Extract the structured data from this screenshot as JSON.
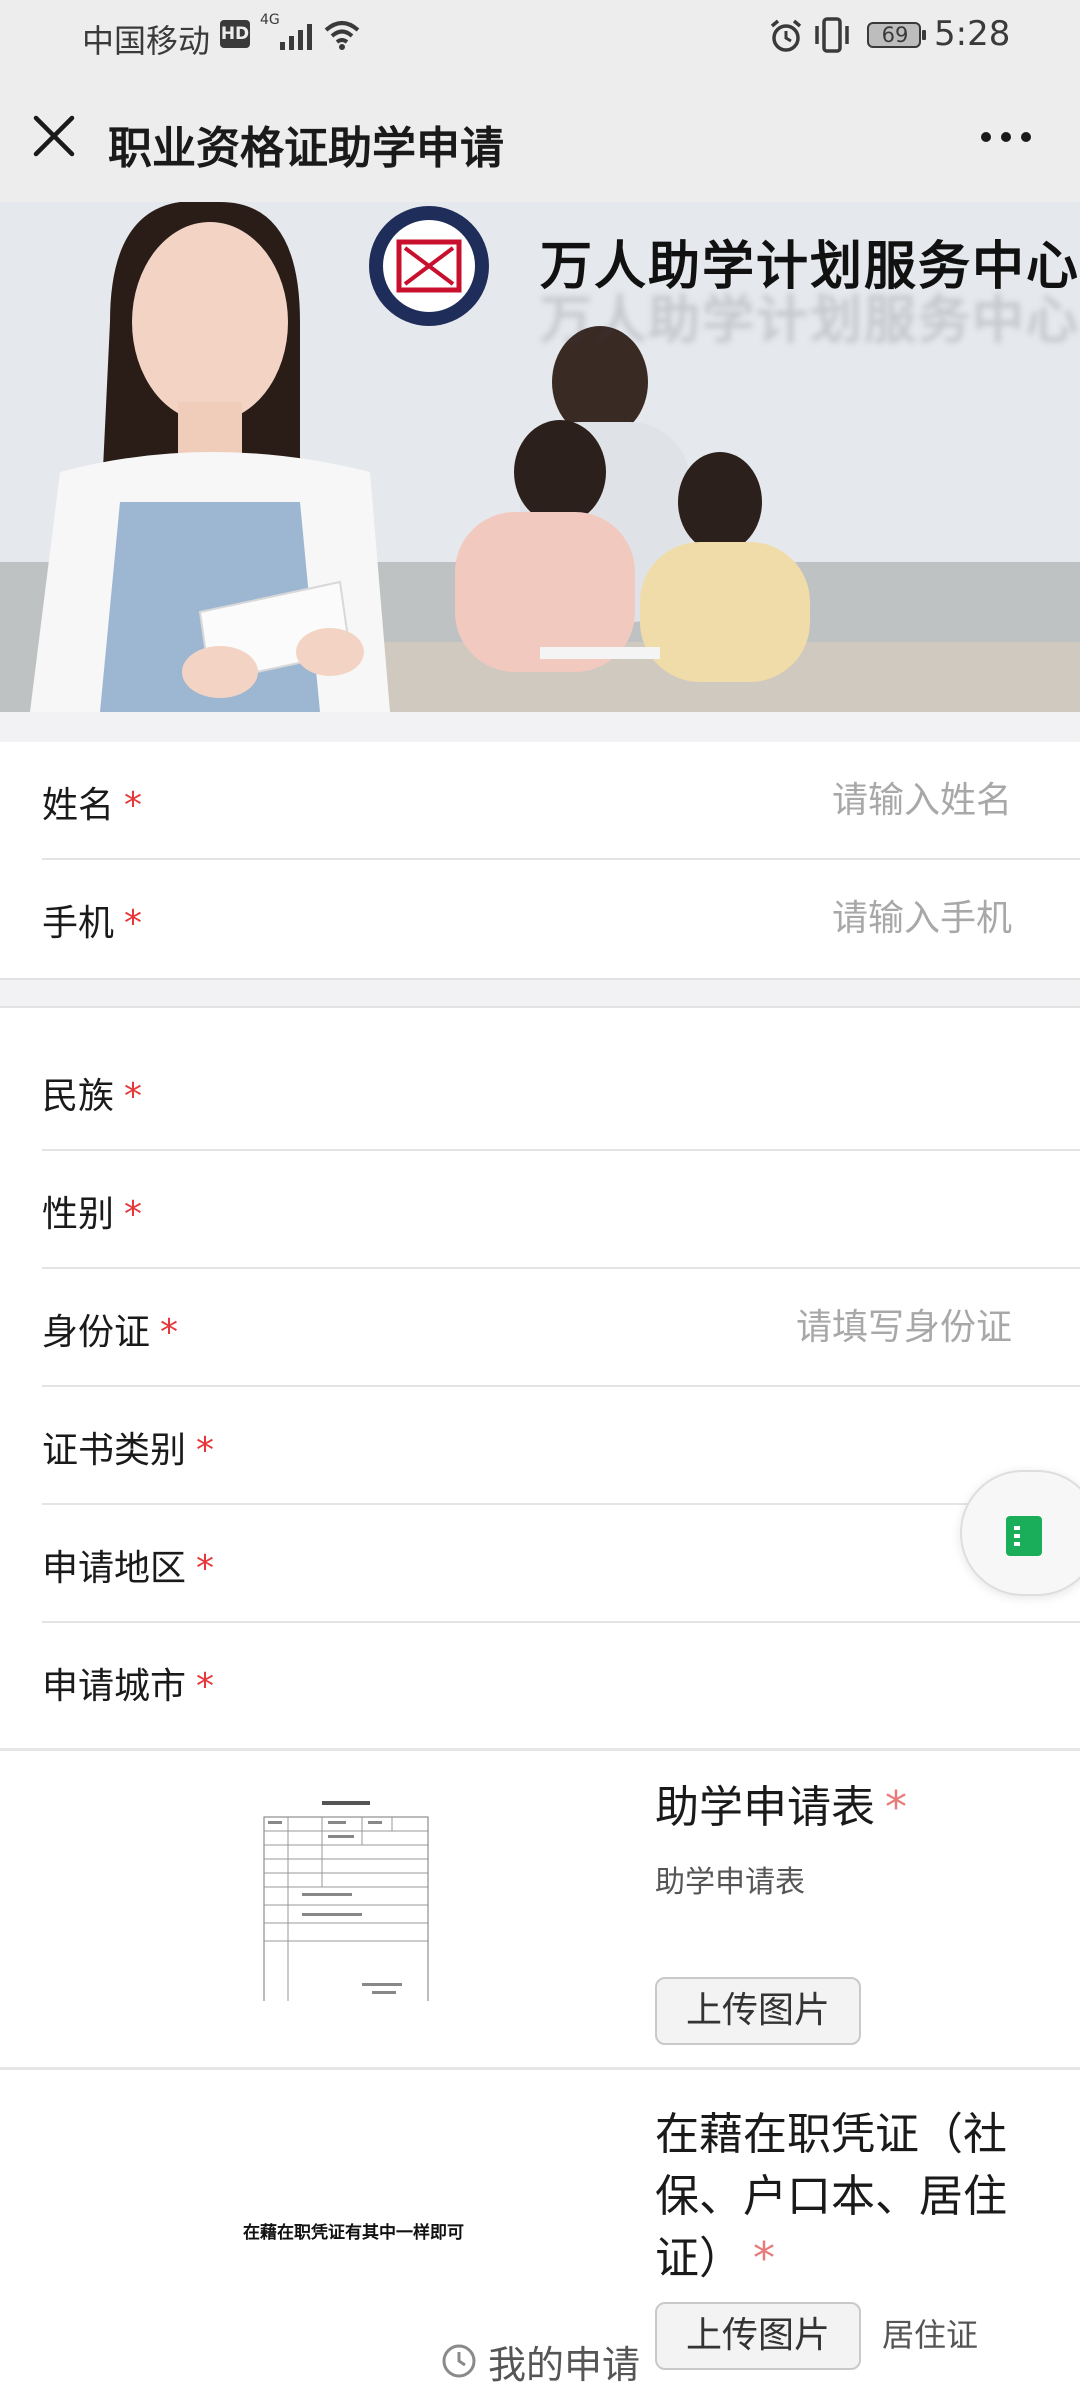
{
  "status_bar": {
    "carrier": "中国移动",
    "hd": "HD",
    "network": "4G",
    "battery": "69",
    "time": "5:28"
  },
  "title_bar": {
    "title": "职业资格证助学申请"
  },
  "banner": {
    "text": "万人助学计划服务中心"
  },
  "form": {
    "required_mark": "*",
    "basic_fields": [
      {
        "label": "姓名",
        "placeholder": "请输入姓名"
      },
      {
        "label": "手机",
        "placeholder": "请输入手机"
      }
    ],
    "detail_fields": [
      {
        "label": "民族",
        "placeholder": ""
      },
      {
        "label": "性别",
        "placeholder": ""
      },
      {
        "label": "身份证",
        "placeholder": "请填写身份证"
      },
      {
        "label": "证书类别",
        "placeholder": ""
      },
      {
        "label": "申请地区",
        "placeholder": ""
      },
      {
        "label": "申请城市",
        "placeholder": ""
      }
    ]
  },
  "uploads": [
    {
      "title": "助学申请表",
      "subtitle": "助学申请表",
      "button": "上传图片"
    },
    {
      "title": "在藉在职凭证（社保、户口本、居住证）",
      "subtitle": "居住证",
      "button": "上传图片",
      "thumb_caption": "在藉在职凭证有其中一样即可"
    }
  ],
  "bottom": {
    "my_application": "我的申请"
  },
  "colors": {
    "required": "#e8373a",
    "placeholder": "#a8a8a8",
    "float_icon": "#1aad5a"
  }
}
